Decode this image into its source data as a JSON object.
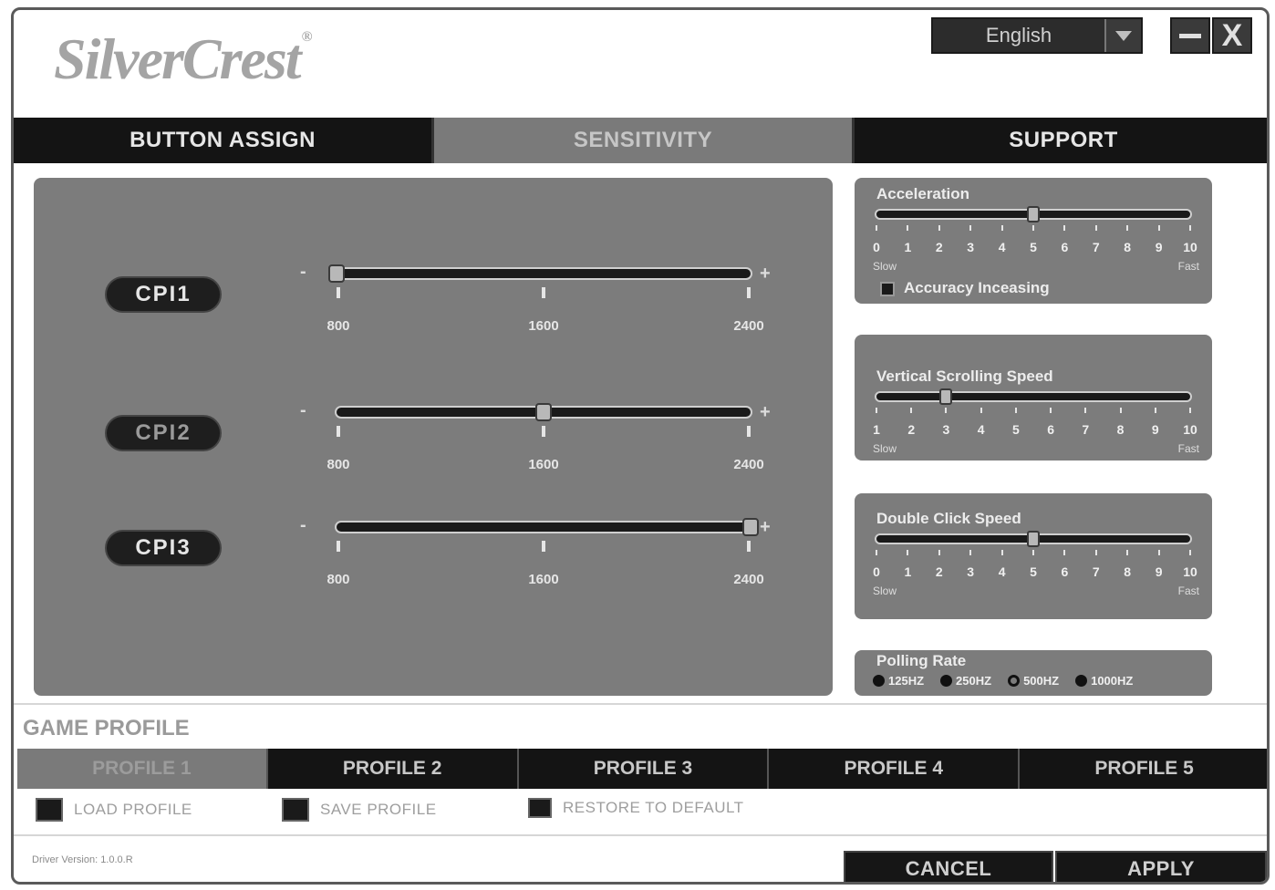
{
  "header": {
    "logo": "SilverCrest",
    "logo_mark": "®",
    "language": "English",
    "minimize_icon": "minimize-icon",
    "close_label": "X"
  },
  "main_tabs": [
    {
      "label": "BUTTON ASSIGN",
      "active": false
    },
    {
      "label": "SENSITIVITY",
      "active": true
    },
    {
      "label": "SUPPORT",
      "active": false
    }
  ],
  "cpi": {
    "minus": "-",
    "plus": "+",
    "rows": [
      {
        "label": "CPI1",
        "ticks": [
          "800",
          "1600",
          "2400"
        ],
        "value": 800
      },
      {
        "label": "CPI2",
        "ticks": [
          "800",
          "1600",
          "2400"
        ],
        "value": 1600
      },
      {
        "label": "CPI3",
        "ticks": [
          "800",
          "1600",
          "2400"
        ],
        "value": 2400
      }
    ]
  },
  "acceleration": {
    "title": "Acceleration",
    "numbers": [
      "0",
      "1",
      "2",
      "3",
      "4",
      "5",
      "6",
      "7",
      "8",
      "9",
      "10"
    ],
    "value": 5,
    "slow": "Slow",
    "fast": "Fast",
    "checkbox_label": "Accuracy Inceasing"
  },
  "vertical_scroll": {
    "title": "Vertical Scrolling Speed",
    "numbers": [
      "1",
      "2",
      "3",
      "4",
      "5",
      "6",
      "7",
      "8",
      "9",
      "10"
    ],
    "value": 3,
    "slow": "Slow",
    "fast": "Fast"
  },
  "double_click": {
    "title": "Double Click Speed",
    "numbers": [
      "0",
      "1",
      "2",
      "3",
      "4",
      "5",
      "6",
      "7",
      "8",
      "9",
      "10"
    ],
    "value": 5,
    "slow": "Slow",
    "fast": "Fast"
  },
  "polling": {
    "title": "Polling Rate",
    "options": [
      {
        "label": "125HZ",
        "selected": false
      },
      {
        "label": "250HZ",
        "selected": false
      },
      {
        "label": "500HZ",
        "selected": true
      },
      {
        "label": "1000HZ",
        "selected": false
      }
    ]
  },
  "game_profile": {
    "title": "GAME PROFILE",
    "tabs": [
      {
        "label": "PROFILE 1",
        "active": true
      },
      {
        "label": "PROFILE 2",
        "active": false
      },
      {
        "label": "PROFILE 3",
        "active": false
      },
      {
        "label": "PROFILE 4",
        "active": false
      },
      {
        "label": "PROFILE 5",
        "active": false
      }
    ],
    "actions": [
      "LOAD PROFILE",
      "SAVE PROFILE",
      "RESTORE TO DEFAULT"
    ]
  },
  "footer": {
    "version": "Driver Version: 1.0.0.R",
    "cancel": "CANCEL",
    "apply": "APPLY"
  }
}
